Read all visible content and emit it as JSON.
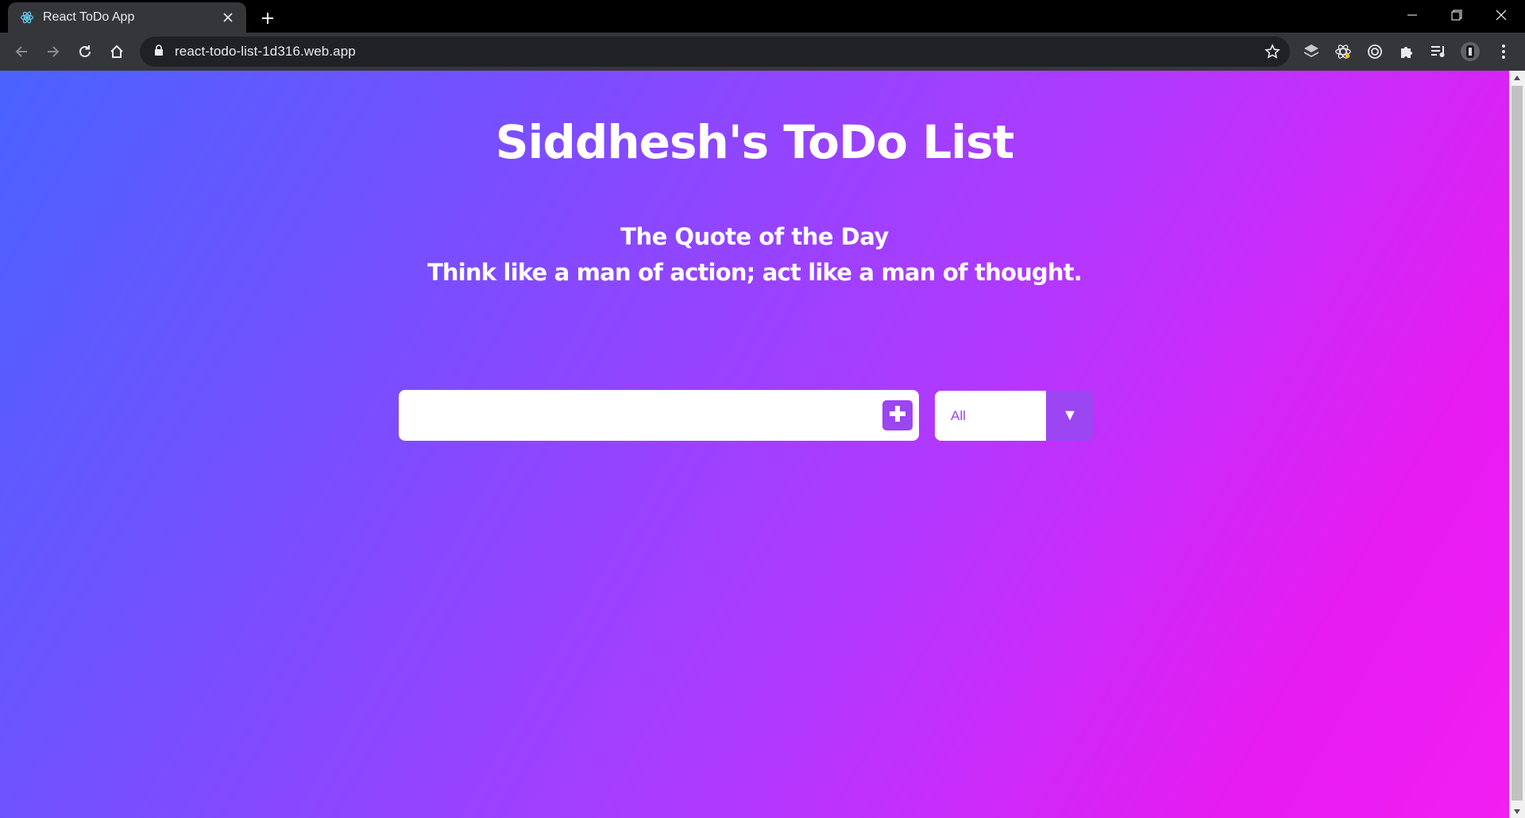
{
  "browser": {
    "tab_title": "React ToDo App",
    "url": "react-todo-list-1d316.web.app"
  },
  "page": {
    "title": "Siddhesh's ToDo List",
    "quote_heading": "The Quote of the Day",
    "quote_text": "Think like a man of action; act like a man of thought."
  },
  "todo_form": {
    "input_value": "",
    "input_placeholder": "",
    "add_icon": "plus-icon",
    "filter_selected": "All",
    "filter_arrow": "▼"
  },
  "colors": {
    "gradient_start": "#4a63ff",
    "gradient_end": "#f21ef2",
    "accent": "#9b45f3"
  }
}
